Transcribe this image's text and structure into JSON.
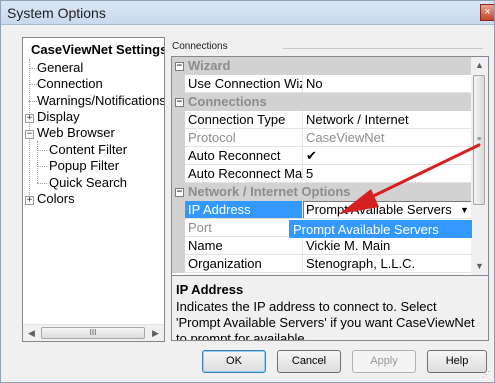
{
  "window": {
    "title": "System Options",
    "close_glyph": "×"
  },
  "tree": {
    "root": "CaseViewNet Settings",
    "items": [
      {
        "label": "General",
        "expander": ""
      },
      {
        "label": "Connection",
        "expander": ""
      },
      {
        "label": "Warnings/Notifications",
        "expander": ""
      },
      {
        "label": "Display",
        "expander": "+"
      },
      {
        "label": "Web Browser",
        "expander": "−"
      },
      {
        "label": "Content Filter",
        "expander": ""
      },
      {
        "label": "Popup Filter",
        "expander": ""
      },
      {
        "label": "Quick Search",
        "expander": ""
      },
      {
        "label": "Colors",
        "expander": "+"
      }
    ],
    "scroll_left": "◀",
    "scroll_right": "▶",
    "scroll_grip": "III"
  },
  "group_label": "Connections",
  "grid": {
    "rows": [
      {
        "kind": "category",
        "expander": "−",
        "label": "Wizard"
      },
      {
        "kind": "property",
        "name": "Use Connection Wizard",
        "value": "No"
      },
      {
        "kind": "category",
        "expander": "−",
        "label": "Connections"
      },
      {
        "kind": "property",
        "name": "Connection Type",
        "value": "Network / Internet"
      },
      {
        "kind": "property",
        "name": "Protocol",
        "value": "CaseViewNet",
        "disabled": true
      },
      {
        "kind": "property",
        "name": "Auto Reconnect",
        "value": "✔"
      },
      {
        "kind": "property",
        "name": "Auto Reconnect Max",
        "value": "5"
      },
      {
        "kind": "category",
        "expander": "−",
        "label": "Network / Internet Options"
      },
      {
        "kind": "property",
        "name": "IP Address",
        "value": "Prompt Available Servers",
        "selected": true,
        "dropdown_glyph": "▼"
      },
      {
        "kind": "property",
        "name": "Port",
        "value": "",
        "disabled": true
      },
      {
        "kind": "property",
        "name": "Name",
        "value": "Vickie M. Main"
      },
      {
        "kind": "property",
        "name": "Organization",
        "value": "Stenograph, L.L.C."
      }
    ],
    "dropdown_option": "Prompt Available Servers",
    "scroll_up": "▲",
    "scroll_down": "▼",
    "scroll_grip": "≡"
  },
  "help": {
    "title": "IP Address",
    "description": "Indicates the IP address to connect to. Select 'Prompt Available Servers' if you want CaseViewNet to prompt for available..."
  },
  "buttons": {
    "ok": "OK",
    "cancel": "Cancel",
    "apply": "Apply",
    "help": "Help"
  },
  "colors": {
    "annotation_arrow": "#d42020",
    "selection": "#3399ff",
    "category_bg": "#d2d2d2"
  },
  "icons": {
    "annotation": "red-arrow-icon"
  }
}
